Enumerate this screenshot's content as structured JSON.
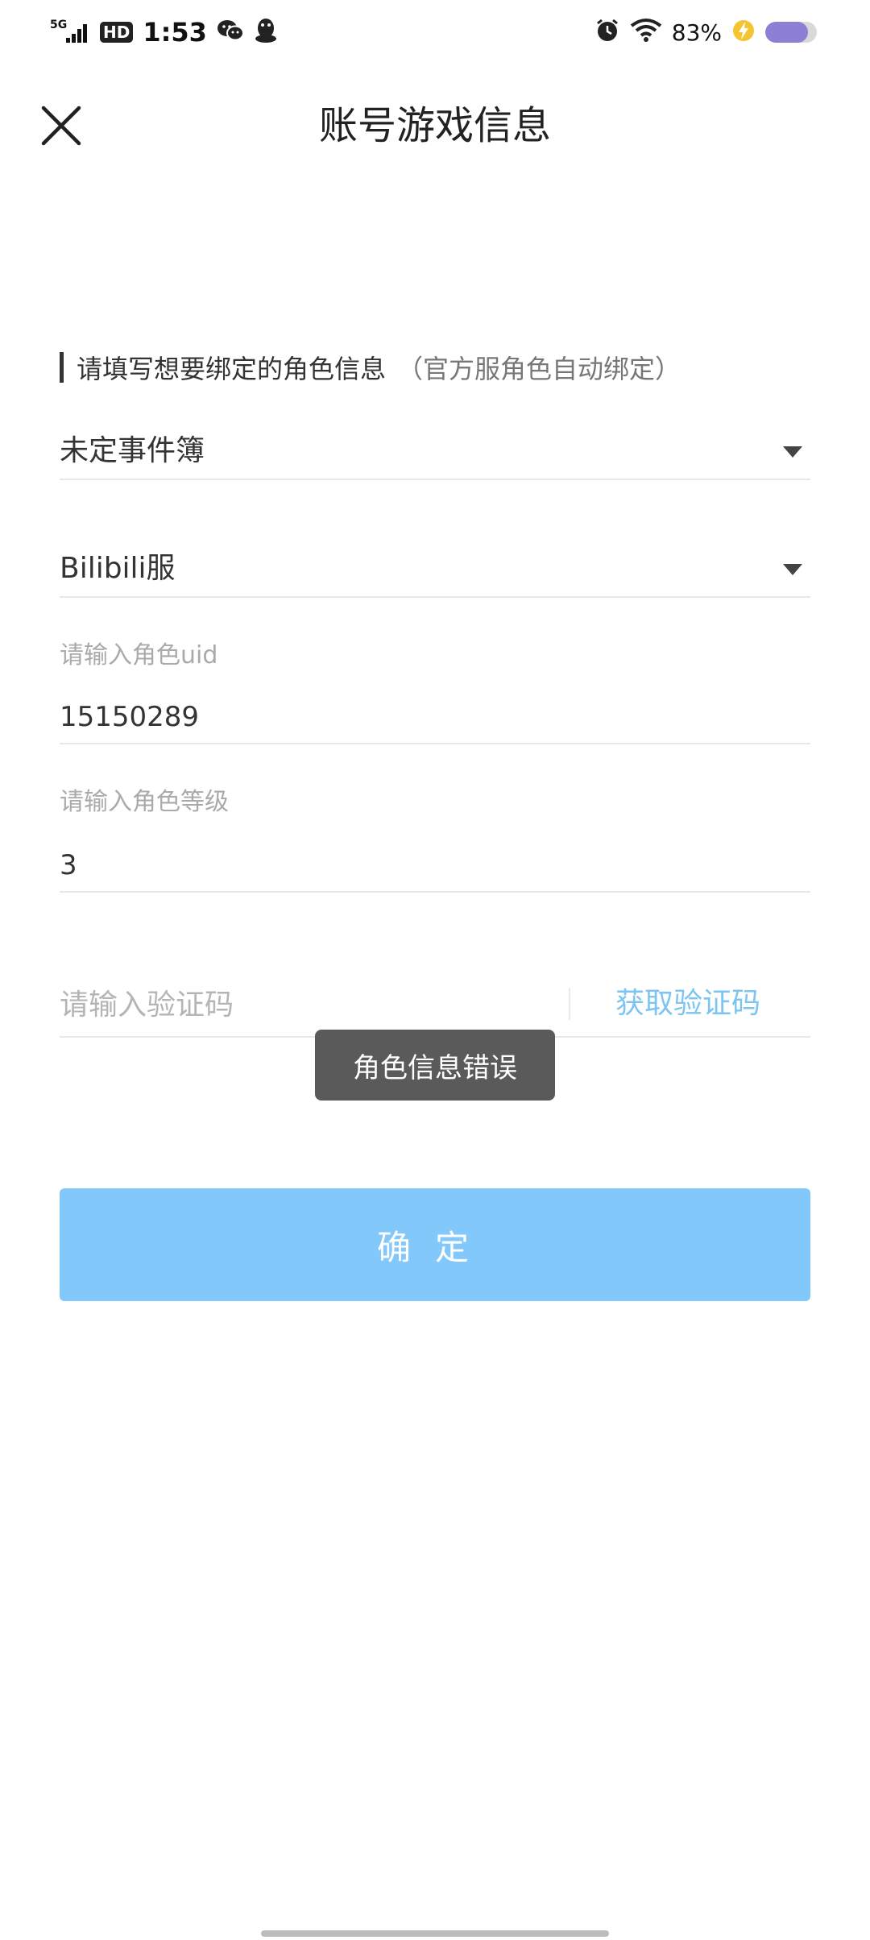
{
  "status_bar": {
    "network": "5G",
    "hd": "HD",
    "time": "1:53",
    "battery_percent_text": "83%",
    "battery_level": 0.83
  },
  "header": {
    "title": "账号游戏信息"
  },
  "form": {
    "section_label": "请填写想要绑定的角色信息",
    "section_hint": "（官方服角色自动绑定）",
    "game_select": {
      "value": "未定事件簿"
    },
    "server_select": {
      "value": "Bilibili服"
    },
    "uid_field": {
      "label": "请输入角色uid",
      "value": "15150289"
    },
    "level_field": {
      "label": "请输入角色等级",
      "value": "3"
    },
    "code_field": {
      "placeholder": "请输入验证码",
      "get_code_label": "获取验证码"
    },
    "confirm_label": "确定"
  },
  "toast": {
    "message": "角色信息错误"
  },
  "colors": {
    "accent": "#82c8fb",
    "link": "#7cc4f2",
    "toast_bg": "#5a5a5a"
  }
}
